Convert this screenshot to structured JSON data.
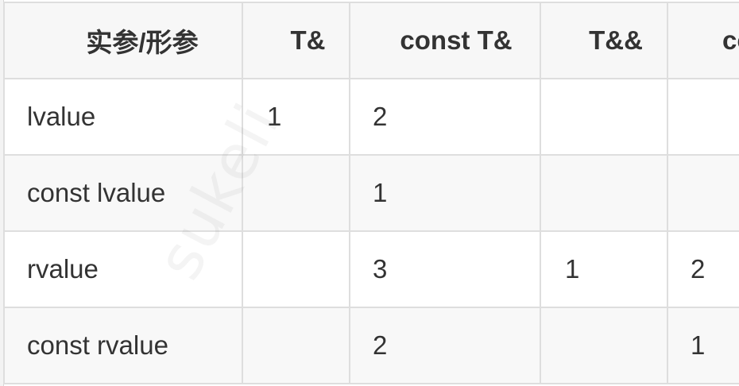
{
  "table": {
    "headers": [
      "实参/形参",
      "T&",
      "const T&",
      "T&&",
      "const T&&"
    ],
    "rows": [
      [
        "lvalue",
        "1",
        "2",
        "",
        ""
      ],
      [
        "const lvalue",
        "",
        "1",
        "",
        ""
      ],
      [
        "rvalue",
        "",
        "3",
        "1",
        "2"
      ],
      [
        "const rvalue",
        "",
        "2",
        "",
        "1"
      ]
    ]
  },
  "watermark": "sukeli"
}
